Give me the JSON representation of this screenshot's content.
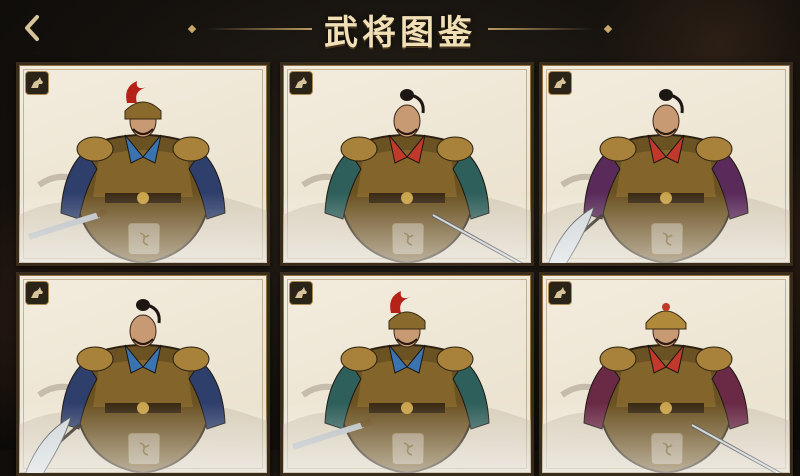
{
  "header": {
    "title": "武将图鉴"
  },
  "icons": {
    "back": "back-arrow-icon",
    "badge": "horse-badge-icon",
    "seal": "seal-icon"
  },
  "colors": {
    "title": "#f1dfb6",
    "frame": "#3a2c1a",
    "card_bg": "#efe7d6",
    "gold": "#b89a62"
  },
  "generals": [
    {
      "helmet": "red-plume",
      "scarf": "#3a73b0",
      "sleeve": "#2f3f6c",
      "weapon": "saber"
    },
    {
      "helmet": "topknot",
      "scarf": "#c0392b",
      "sleeve": "#2f5f5a",
      "weapon": "sword"
    },
    {
      "helmet": "topknot",
      "scarf": "#c0392b",
      "sleeve": "#5a2b5a",
      "weapon": "glaive"
    },
    {
      "helmet": "topknot",
      "scarf": "#3a73b0",
      "sleeve": "#2f3f6c",
      "weapon": "glaive"
    },
    {
      "helmet": "red-plume",
      "scarf": "#3a73b0",
      "sleeve": "#2f5f5a",
      "weapon": "saber"
    },
    {
      "helmet": "gold-helm",
      "scarf": "#c0392b",
      "sleeve": "#6a2a45",
      "weapon": "sword"
    }
  ]
}
